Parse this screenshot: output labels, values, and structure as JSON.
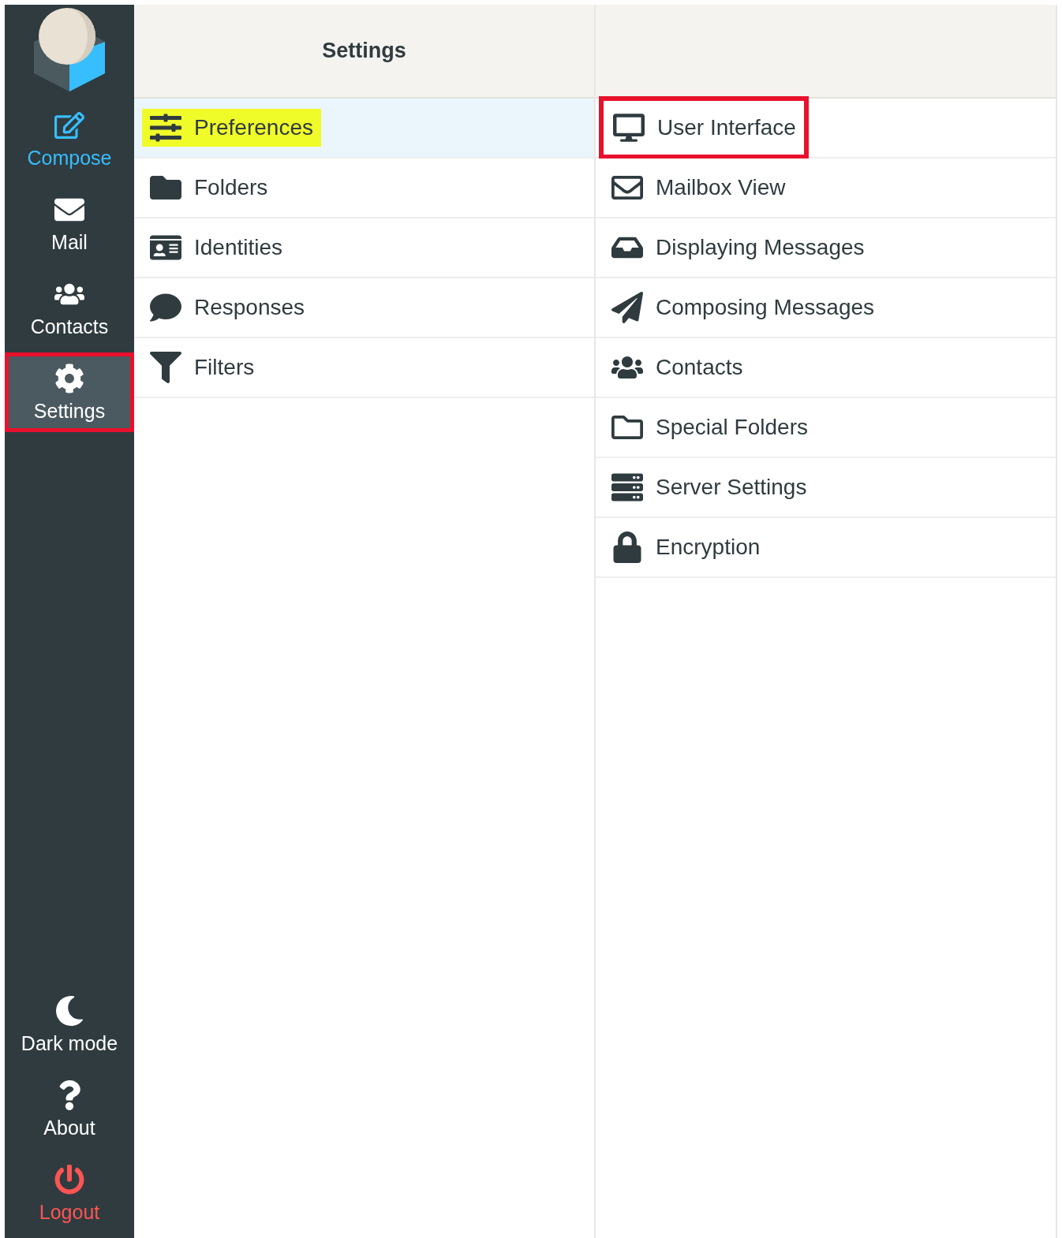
{
  "sidebar": {
    "items": [
      {
        "label": "Compose",
        "kind": "action",
        "selected": false,
        "boxed": false
      },
      {
        "label": "Mail",
        "kind": "nav",
        "selected": false,
        "boxed": false
      },
      {
        "label": "Contacts",
        "kind": "nav",
        "selected": false,
        "boxed": false
      },
      {
        "label": "Settings",
        "kind": "nav",
        "selected": true,
        "boxed": true
      }
    ],
    "bottom_items": [
      {
        "label": "Dark mode",
        "kind": "nav"
      },
      {
        "label": "About",
        "kind": "nav"
      },
      {
        "label": "Logout",
        "kind": "danger"
      }
    ]
  },
  "sections": {
    "title": "Settings",
    "items": [
      {
        "label": "Preferences",
        "selected": true,
        "highlighted": true
      },
      {
        "label": "Folders",
        "selected": false,
        "highlighted": false
      },
      {
        "label": "Identities",
        "selected": false,
        "highlighted": false
      },
      {
        "label": "Responses",
        "selected": false,
        "highlighted": false
      },
      {
        "label": "Filters",
        "selected": false,
        "highlighted": false
      }
    ]
  },
  "preferences": {
    "items": [
      {
        "label": "User Interface",
        "boxed": true
      },
      {
        "label": "Mailbox View",
        "boxed": false
      },
      {
        "label": "Displaying Messages",
        "boxed": false
      },
      {
        "label": "Composing Messages",
        "boxed": false
      },
      {
        "label": "Contacts",
        "boxed": false
      },
      {
        "label": "Special Folders",
        "boxed": false
      },
      {
        "label": "Server Settings",
        "boxed": false
      },
      {
        "label": "Encryption",
        "boxed": false
      }
    ]
  }
}
